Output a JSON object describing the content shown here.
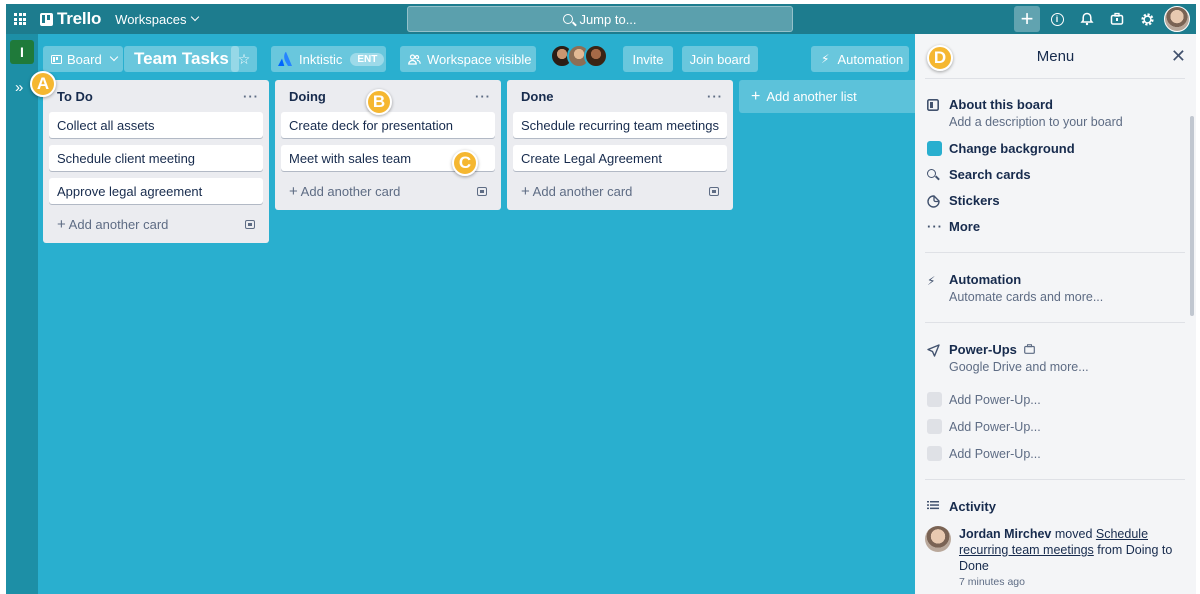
{
  "topnav": {
    "logo": "Trello",
    "workspaces_label": "Workspaces",
    "search_label": "Jump to..."
  },
  "rail": {
    "workspace_initial": "I"
  },
  "board_header": {
    "view_label": "Board",
    "title": "Team Tasks",
    "workspace_name": "Inktistic",
    "workspace_badge": "ENT",
    "visibility_label": "Workspace visible",
    "invite_label": "Invite",
    "join_label": "Join board",
    "automation_label": "Automation"
  },
  "lists": [
    {
      "title": "To Do",
      "cards": [
        "Collect all assets",
        "Schedule client meeting",
        "Approve legal agreement"
      ],
      "add_card_label": "Add another card"
    },
    {
      "title": "Doing",
      "cards": [
        "Create deck for presentation",
        "Meet with sales team"
      ],
      "add_card_label": "Add another card"
    },
    {
      "title": "Done",
      "cards": [
        "Schedule recurring team meetings",
        "Create Legal Agreement"
      ],
      "add_card_label": "Add another card"
    }
  ],
  "add_list_label": "Add another list",
  "callouts": [
    "A",
    "B",
    "C",
    "D"
  ],
  "menu": {
    "title": "Menu",
    "about": {
      "label": "About this board",
      "sub": "Add a description to your board"
    },
    "change_background": "Change background",
    "search_cards": "Search cards",
    "stickers": "Stickers",
    "more": "More",
    "automation": {
      "label": "Automation",
      "sub": "Automate cards and more..."
    },
    "powerups": {
      "label": "Power-Ups",
      "sub": "Google Drive and more...",
      "add_items": [
        "Add Power-Up...",
        "Add Power-Up...",
        "Add Power-Up..."
      ]
    },
    "activity": {
      "label": "Activity",
      "user": "Jordan Mirchev",
      "verb": "moved",
      "card": "Schedule recurring team meetings",
      "from_to": "from Doing to Done",
      "time": "7 minutes ago"
    }
  },
  "colors": {
    "board_bg": "#29afcf",
    "nav_bg": "#1d7c8e",
    "callout": "#f5b731",
    "workspace_tile": "#1f7a3a"
  }
}
